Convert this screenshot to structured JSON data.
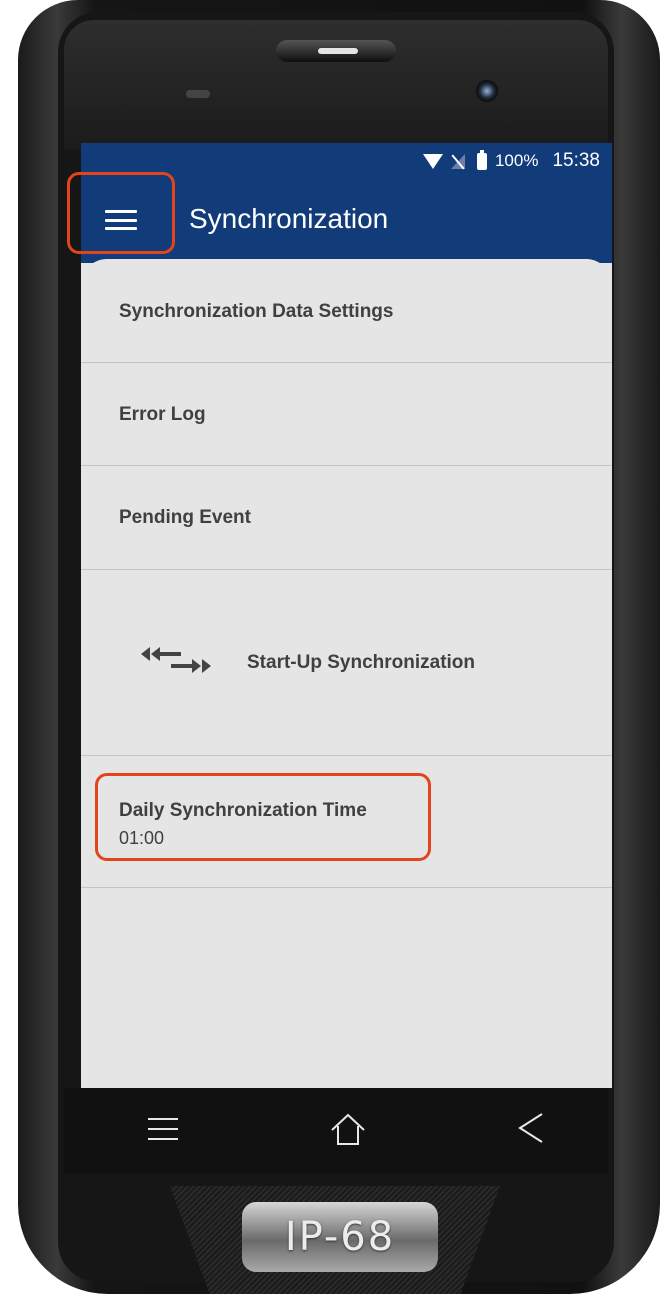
{
  "statusbar": {
    "battery": "100%",
    "time": "15:38"
  },
  "appbar": {
    "title": "Synchronization",
    "menu_icon": "hamburger-menu-icon"
  },
  "menu": {
    "items": [
      {
        "label": "Synchronization Data Settings"
      },
      {
        "label": "Error Log"
      },
      {
        "label": "Pending Event"
      },
      {
        "label": "Start-Up Synchronization",
        "icon": "sync-arrows-icon"
      },
      {
        "label": "Daily Synchronization Time",
        "value": "01:00"
      }
    ]
  },
  "navbar": {
    "menu_icon": "nav-menu-icon",
    "home_icon": "home-icon",
    "back_icon": "back-icon"
  },
  "device": {
    "badge": "IP-68"
  },
  "colors": {
    "appbar": "#123b7a",
    "highlight": "#e2451c",
    "content_bg": "#e5e5e5"
  }
}
